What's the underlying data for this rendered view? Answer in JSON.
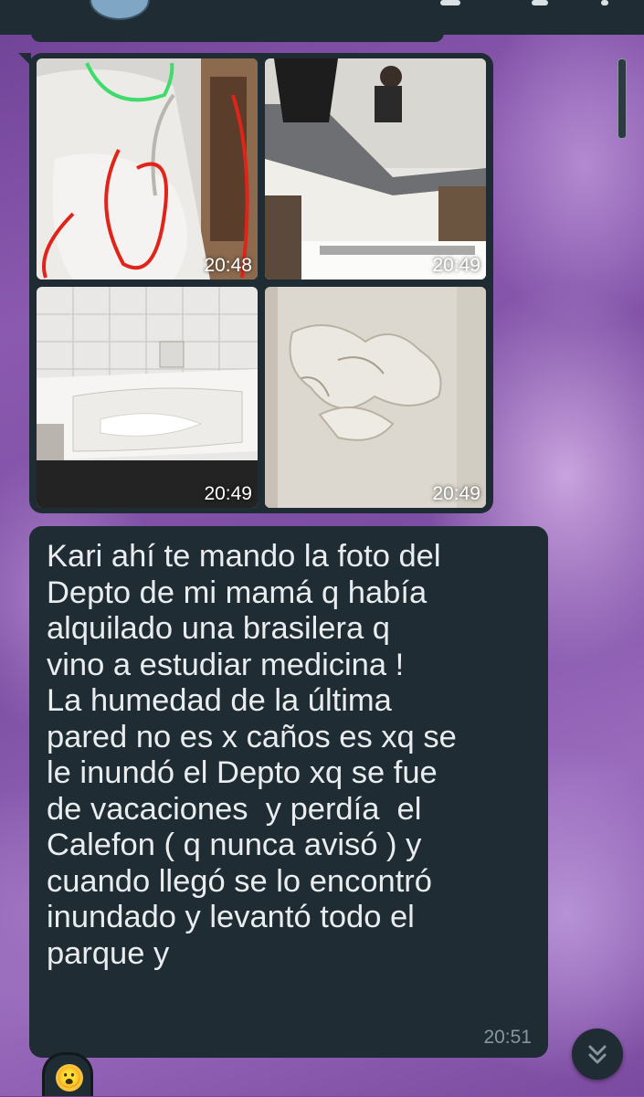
{
  "chat": {
    "image_message": {
      "images": [
        {
          "icon": "bathtub-marked-photo",
          "time": "20:48"
        },
        {
          "icon": "kitchen-counter-photo",
          "time": "20:49"
        },
        {
          "icon": "bathtub-photo",
          "time": "20:49"
        },
        {
          "icon": "damp-wall-photo",
          "time": "20:49"
        }
      ]
    },
    "text_message": {
      "text": "Kari ahí te mando la foto del\nDepto de mi mamá q había\nalquilado una brasilera q\nvino a estudiar medicina !\nLa humedad de la última\npared no es x caños es xq se\nle inundó el Depto xq se fue\nde vacaciones  y perdía  el\nCalefon ( q nunca avisó ) y\ncuando llegó se lo encontró\ninundado y levantó todo el\nparque y",
      "time": "20:51"
    },
    "reaction": {
      "emoji": "😮"
    },
    "scroll_down": {
      "icon": "chevron-double-down-icon",
      "label": "≫"
    }
  },
  "colors": {
    "bubble": "#1f2c33",
    "text": "#e9edef",
    "meta": "#8696a0",
    "annotation_red": "#e0241a",
    "annotation_green": "#3fdc6b"
  }
}
